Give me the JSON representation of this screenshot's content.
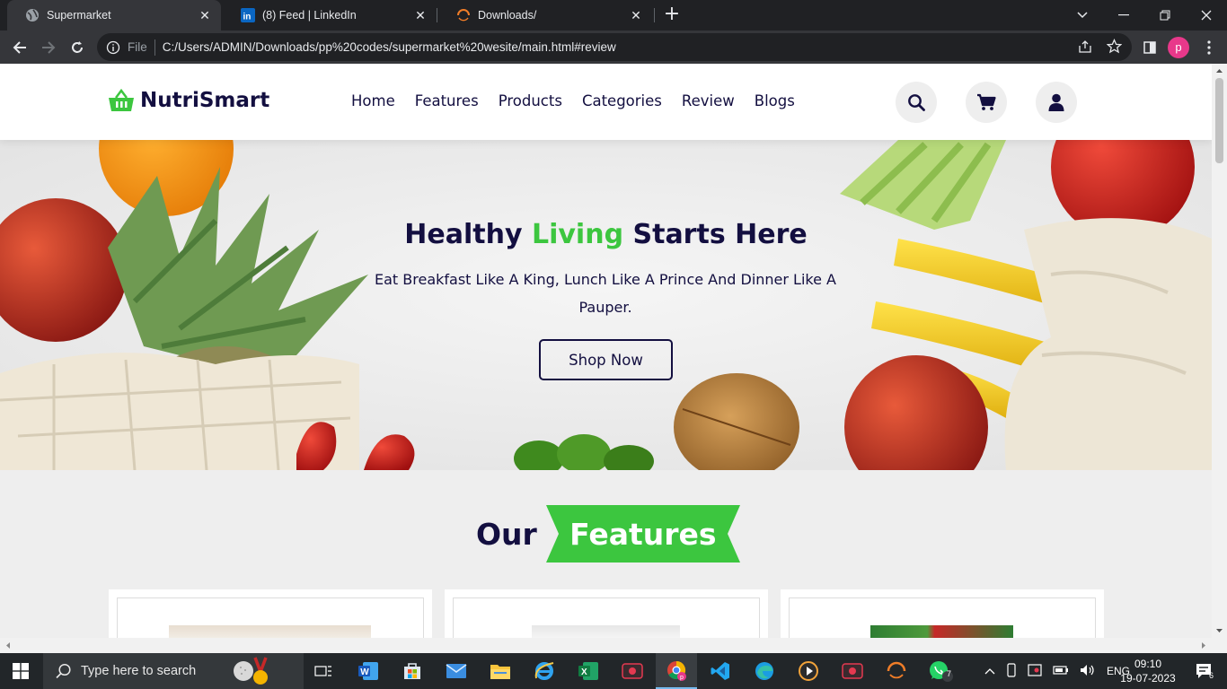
{
  "browser": {
    "tabs": [
      {
        "title": "Supermarket",
        "active": true
      },
      {
        "title": "(8) Feed | LinkedIn",
        "active": false
      },
      {
        "title": "Downloads/",
        "active": false
      }
    ],
    "address": {
      "scheme": "File",
      "url": "C:/Users/ADMIN/Downloads/pp%20codes/supermarket%20wesite/main.html#review"
    },
    "profile_initial": "p"
  },
  "site": {
    "brand": "NutriSmart",
    "nav": [
      "Home",
      "Features",
      "Products",
      "Categories",
      "Review",
      "Blogs"
    ],
    "header_icons": [
      "search-icon",
      "cart-icon",
      "user-icon"
    ],
    "hero": {
      "title_part1": "Healthy ",
      "title_highlight": "Living",
      "title_part2": " Starts Here",
      "subtitle": "Eat Breakfast Like A King, Lunch Like A Prince And Dinner Like A Pauper.",
      "button": "Shop Now"
    },
    "features_heading": {
      "prefix": "Our",
      "highlight": "Features"
    },
    "colors": {
      "accent": "#3cc63f",
      "dark": "#130f40",
      "page_bg": "#eeeeee"
    }
  },
  "taskbar": {
    "search_placeholder": "Type here to search",
    "language": "ENG",
    "time": "09:10",
    "date": "19-07-2023",
    "whatsapp_badge": "7",
    "notification_count": "6"
  }
}
